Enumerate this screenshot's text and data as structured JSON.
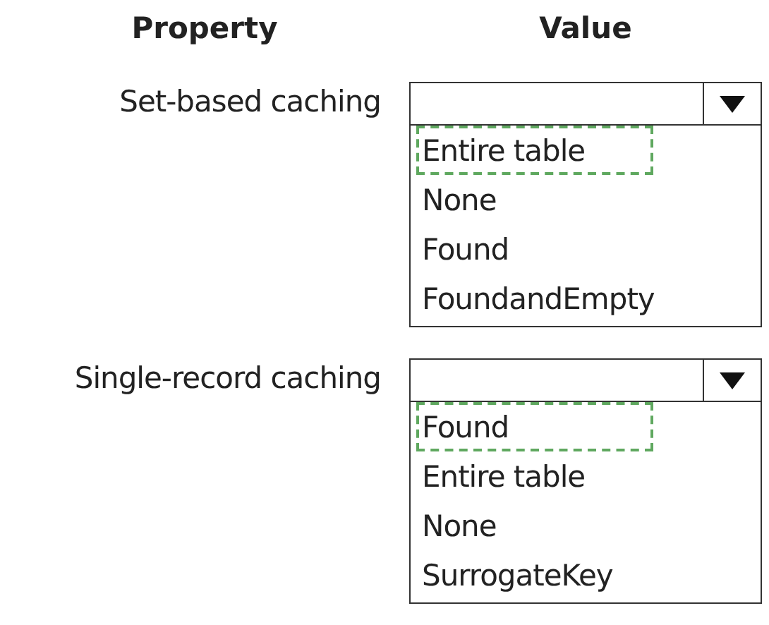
{
  "headers": {
    "property": "Property",
    "value": "Value"
  },
  "properties": [
    {
      "label": "Set-based caching",
      "options": [
        {
          "label": "Entire table",
          "selected": true
        },
        {
          "label": "None",
          "selected": false
        },
        {
          "label": "Found",
          "selected": false
        },
        {
          "label": "FoundandEmpty",
          "selected": false
        }
      ]
    },
    {
      "label": "Single-record caching",
      "options": [
        {
          "label": "Found",
          "selected": true
        },
        {
          "label": "Entire table",
          "selected": false
        },
        {
          "label": "None",
          "selected": false
        },
        {
          "label": "SurrogateKey",
          "selected": false
        }
      ]
    }
  ]
}
